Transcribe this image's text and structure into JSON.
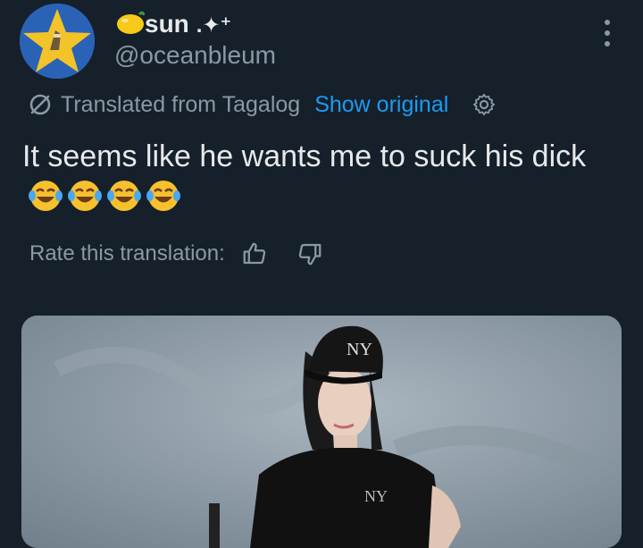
{
  "tweet": {
    "display_name": "sun",
    "display_name_prefix_emoji": "lemon",
    "display_name_suffix": ".✦⁺",
    "handle": "@oceanbleum",
    "more_icon": "more-vertical-icon"
  },
  "translation": {
    "translated_label": "Translated from Tagalog",
    "show_original_label": "Show original",
    "colors": {
      "muted": "#8b98a5",
      "link": "#1d9bf0"
    }
  },
  "body": {
    "text": "It seems like he wants me to suck his dick",
    "emojis": [
      "face-with-tears-of-joy",
      "face-with-tears-of-joy",
      "face-with-tears-of-joy",
      "face-with-tears-of-joy"
    ]
  },
  "rating": {
    "label": "Rate this translation:",
    "thumbs_up_icon": "thumbs-up-icon",
    "thumbs_down_icon": "thumbs-down-icon"
  },
  "media": {
    "description_icon": "photo-woman-black-cap-ny"
  },
  "colors": {
    "background": "#15202b",
    "text": "#e7e9ea"
  }
}
